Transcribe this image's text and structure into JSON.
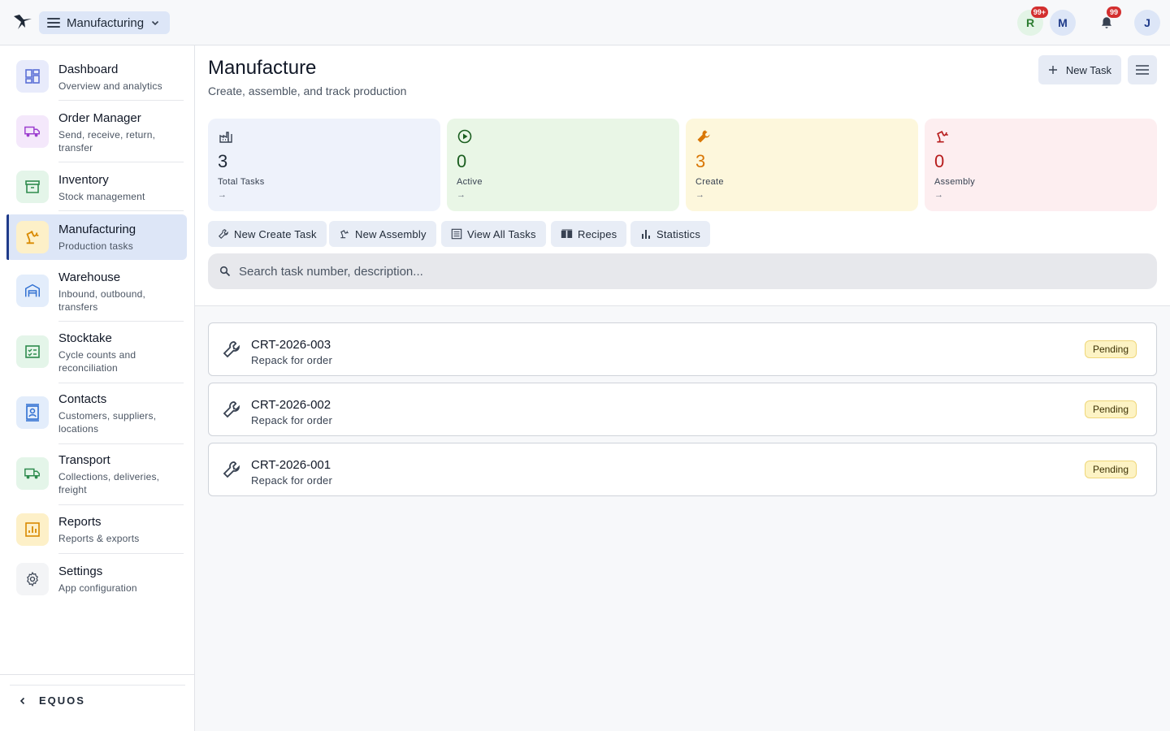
{
  "topbar": {
    "app_name": "Manufacturing",
    "avatars": [
      {
        "letter": "R",
        "badge": "99+",
        "bg": "#e3f4e6",
        "fg": "#2e7d32"
      },
      {
        "letter": "M",
        "bg": "#dde6f7",
        "fg": "#1f3b8a"
      },
      {
        "letter": "J",
        "bg": "#dde6f7",
        "fg": "#1f3b8a"
      }
    ],
    "notifications_badge": "99"
  },
  "sidebar": {
    "items": [
      {
        "label": "Dashboard",
        "desc": "Overview and analytics",
        "icon": "dashboard-icon",
        "color": "#5b6fd6",
        "bg": "#e8ebfb"
      },
      {
        "label": "Order Manager",
        "desc": "Send, receive, return, transfer",
        "icon": "truck-icon",
        "color": "#9c3ecf",
        "bg": "#f4e8fb"
      },
      {
        "label": "Inventory",
        "desc": "Stock management",
        "icon": "archive-icon",
        "color": "#2e8b4e",
        "bg": "#e4f5e9"
      },
      {
        "label": "Manufacturing",
        "desc": "Production tasks",
        "icon": "robot-arm-icon",
        "color": "#d98a00",
        "bg": "#fdf0c8"
      },
      {
        "label": "Warehouse",
        "desc": "Inbound, outbound, transfers",
        "icon": "warehouse-icon",
        "color": "#2f6fd1",
        "bg": "#e3edfb"
      },
      {
        "label": "Stocktake",
        "desc": "Cycle counts and reconciliation",
        "icon": "checklist-icon",
        "color": "#2e8b4e",
        "bg": "#e4f5e9"
      },
      {
        "label": "Contacts",
        "desc": "Customers, suppliers, locations",
        "icon": "contacts-icon",
        "color": "#2f6fd1",
        "bg": "#e3edfb"
      },
      {
        "label": "Transport",
        "desc": "Collections, deliveries, freight",
        "icon": "truck-icon",
        "color": "#2e8b4e",
        "bg": "#e4f5e9"
      },
      {
        "label": "Reports",
        "desc": "Reports & exports",
        "icon": "chart-icon",
        "color": "#d98a00",
        "bg": "#fdf0c8"
      },
      {
        "label": "Settings",
        "desc": "App configuration",
        "icon": "gear-icon",
        "color": "#374151",
        "bg": "#f3f4f6"
      }
    ],
    "footer_label": "EQUOS"
  },
  "main": {
    "title": "Manufacture",
    "subtitle": "Create, assemble, and track production",
    "new_task_label": "New Task",
    "stats": [
      {
        "value": "3",
        "label": "Total Tasks",
        "icon": "factory-icon",
        "bg": "#eef2fb",
        "color": "#1f2937"
      },
      {
        "value": "0",
        "label": "Active",
        "icon": "play-circle-icon",
        "bg": "#e9f6e6",
        "color": "#1b5e20"
      },
      {
        "value": "3",
        "label": "Create",
        "icon": "wrench-icon",
        "bg": "#fdf7dc",
        "color": "#d97706"
      },
      {
        "value": "0",
        "label": "Assembly",
        "icon": "robot-arm-icon",
        "bg": "#fdeef0",
        "color": "#b71c1c"
      }
    ],
    "quick_actions": [
      {
        "label": "New Create Task",
        "icon": "wrench-icon"
      },
      {
        "label": "New Assembly",
        "icon": "robot-arm-icon"
      },
      {
        "label": "View All Tasks",
        "icon": "list-icon"
      },
      {
        "label": "Recipes",
        "icon": "book-icon"
      },
      {
        "label": "Statistics",
        "icon": "bar-chart-icon"
      }
    ],
    "search_placeholder": "Search task number, description...",
    "tasks": [
      {
        "number": "CRT-2026-003",
        "description": "Repack for order",
        "status": "Pending"
      },
      {
        "number": "CRT-2026-002",
        "description": "Repack for order",
        "status": "Pending"
      },
      {
        "number": "CRT-2026-001",
        "description": "Repack for order",
        "status": "Pending"
      }
    ]
  }
}
